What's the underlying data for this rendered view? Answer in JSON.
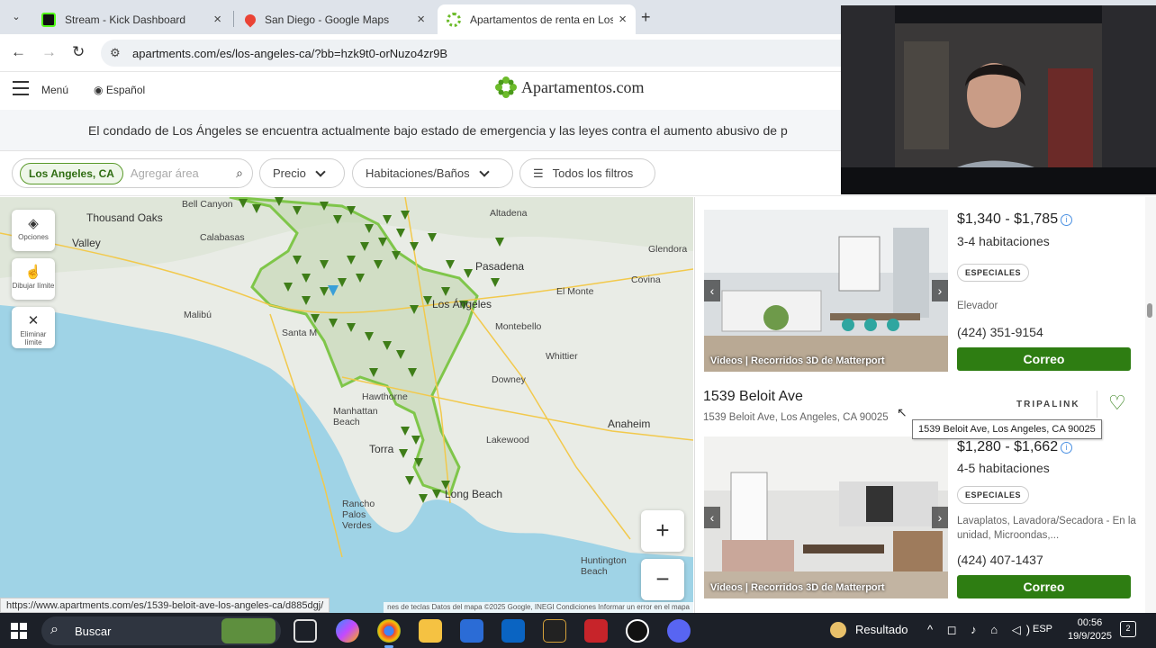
{
  "browser": {
    "tabs": [
      {
        "title": "Stream - Kick Dashboard",
        "favicon_color": "#53fc18"
      },
      {
        "title": "San Diego - Google Maps",
        "favicon_color": "#34a853"
      },
      {
        "title": "Apartamentos de renta en Los Á",
        "favicon_color": "#6cbb2a"
      }
    ],
    "url": "apartments.com/es/los-angeles-ca/?bb=hzk9t0-orNuzo4zr9B"
  },
  "site": {
    "menu_label": "Menú",
    "language": "Español",
    "logo_text": "Apartamentos.com",
    "banner": "El condado de Los Ángeles se encuentra actualmente bajo estado de emergencia y las leyes contra el aumento abusivo de p"
  },
  "filters": {
    "location_chip": "Los Angeles, CA",
    "area_placeholder": "Agregar área",
    "price": "Precio",
    "rooms": "Habitaciones/Baños",
    "all_filters": "Todos los filtros"
  },
  "map": {
    "controls": {
      "options": "Opciones",
      "draw": "Dibujar límite",
      "clear": "Eliminar límite"
    },
    "labels": [
      "Thousand Oaks",
      "Valley",
      "Bell Canyon",
      "Calabasas",
      "Altadena",
      "Pasadena",
      "Glendora",
      "Covina",
      "El Monte",
      "Montebello",
      "Whittier",
      "Malibú",
      "Santa M",
      "Los Ángeles",
      "Hawthorne",
      "Manhattan Beach",
      "Downey",
      "Lakewood",
      "Anaheim",
      "Torra",
      "Rancho Palos Verdes",
      "Long Beach",
      "Huntington Beach"
    ],
    "footer": "nes de teclas   Datos del mapa ©2025 Google, INEGI   Condiciones   Informar un error en el mapa"
  },
  "status_url": "https://www.apartments.com/es/1539-beloit-ave-los-angeles-ca/d885dgj/",
  "listings": [
    {
      "price": "$1,340 - $1,785",
      "beds": "3-4 habitaciones",
      "badge": "ESPECIALES",
      "amenities": "Elevador",
      "phone": "(424) 351-9154",
      "email": "Correo",
      "photo_tags": "Videos  |  Recorridos 3D de Matterport"
    },
    {
      "title": "1539 Beloit Ave",
      "address": "1539 Beloit Ave, Los Angeles, CA 90025",
      "brand": "TRIPALINK",
      "tooltip": "1539 Beloit Ave, Los Angeles, CA 90025",
      "price": "$1,280 - $1,662",
      "beds": "4-5 habitaciones",
      "badge": "ESPECIALES",
      "amenities": "Lavaplatos, Lavadora/Secadora - En la unidad, Microondas,...",
      "phone": "(424) 407-1437",
      "email": "Correo",
      "photo_tags": "Videos  |  Recorridos 3D de Matterport"
    }
  ],
  "taskbar": {
    "search": "Buscar",
    "result": "Resultado",
    "lang": "ESP",
    "time": "00:56",
    "date": "19/9/2025",
    "notifications": "2"
  }
}
